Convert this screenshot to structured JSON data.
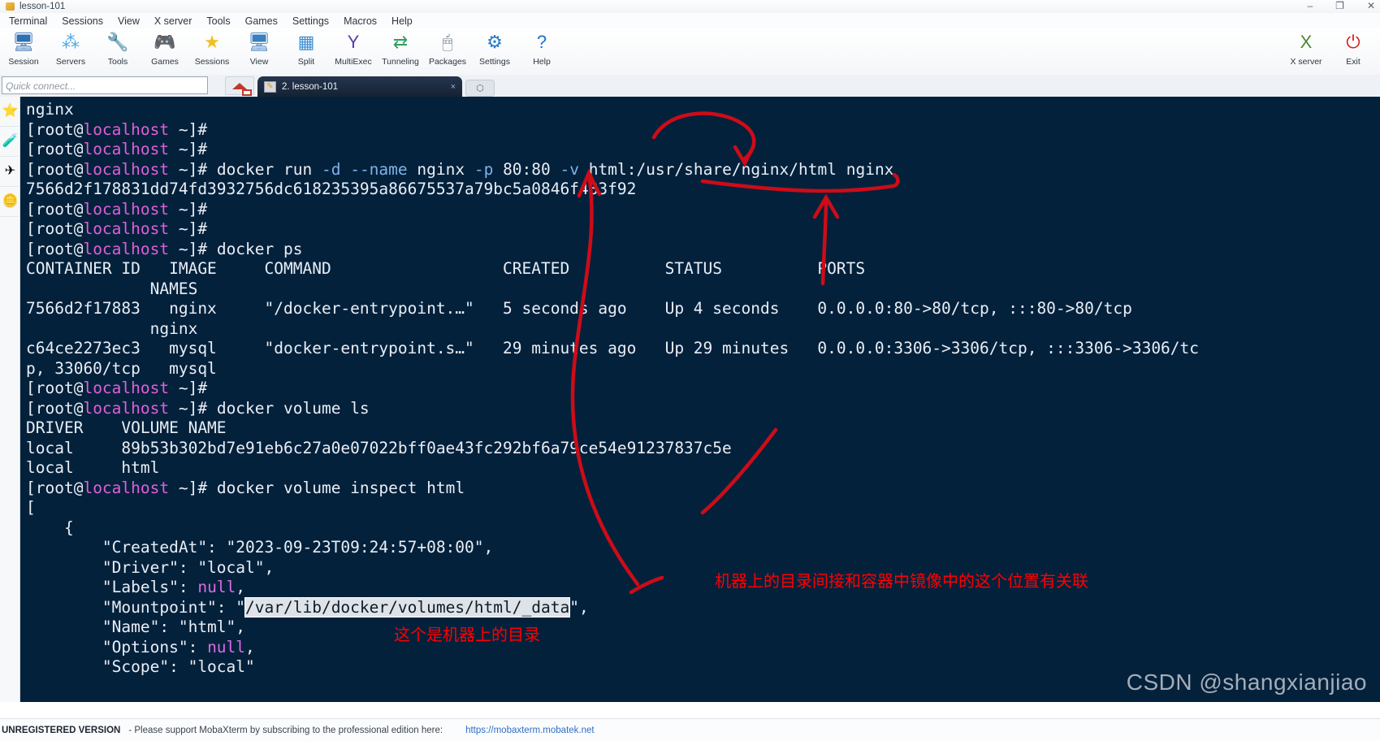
{
  "window": {
    "title": "lesson-101",
    "icon": "mobaxterm-icon",
    "buttons": [
      "–",
      "❐",
      "✕"
    ]
  },
  "menu": {
    "items": [
      "Terminal",
      "Sessions",
      "View",
      "X server",
      "Tools",
      "Games",
      "Settings",
      "Macros",
      "Help"
    ]
  },
  "toolbar": {
    "items": [
      {
        "label": "Session",
        "icon": "session-icon",
        "glyph": "🖥"
      },
      {
        "label": "Servers",
        "icon": "servers-icon",
        "glyph": "⁂"
      },
      {
        "label": "Tools",
        "icon": "tools-icon",
        "glyph": "🔧"
      },
      {
        "label": "Games",
        "icon": "games-icon",
        "glyph": "🎮"
      },
      {
        "label": "Sessions",
        "icon": "star-sessions-icon",
        "glyph": "★"
      },
      {
        "label": "View",
        "icon": "view-icon",
        "glyph": "🖥"
      },
      {
        "label": "Split",
        "icon": "split-icon",
        "glyph": "▦"
      },
      {
        "label": "MultiExec",
        "icon": "multiexec-icon",
        "glyph": "Y"
      },
      {
        "label": "Tunneling",
        "icon": "tunneling-icon",
        "glyph": "⇄"
      },
      {
        "label": "Packages",
        "icon": "packages-icon",
        "glyph": "🖱"
      },
      {
        "label": "Settings",
        "icon": "settings-gear-icon",
        "glyph": "⚙"
      },
      {
        "label": "Help",
        "icon": "help-icon",
        "glyph": "?"
      }
    ],
    "right_items": [
      {
        "label": "X server",
        "icon": "x-server-icon",
        "glyph": "X"
      },
      {
        "label": "Exit",
        "icon": "exit-power-icon",
        "glyph": "⏻"
      }
    ]
  },
  "quick_connect": {
    "placeholder": "Quick connect...",
    "value": "",
    "home_icon": "home-icon"
  },
  "tabs": {
    "active": {
      "label": "2. lesson-101",
      "icon": "terminal-tab-icon",
      "close_label": "×"
    },
    "new_tab_label": "⬡"
  },
  "sidebar": {
    "items": [
      {
        "icon": "favorites-star-icon",
        "glyph": "⭐"
      },
      {
        "icon": "tools-wrench-icon",
        "glyph": "🧪"
      },
      {
        "icon": "sftp-plane-icon",
        "glyph": "✈"
      },
      {
        "icon": "macros-coin-icon",
        "glyph": "🪙"
      }
    ]
  },
  "terminal": {
    "prompt_user": "[root@",
    "prompt_host": "localhost",
    "prompt_tail": " ~]# ",
    "lines": [
      {
        "segments": [
          {
            "t": "nginx"
          }
        ]
      },
      {
        "prompt": true,
        "segments": [
          {
            "t": ""
          }
        ]
      },
      {
        "prompt": true,
        "segments": [
          {
            "t": ""
          }
        ]
      },
      {
        "prompt": true,
        "segments": [
          {
            "t": "docker run "
          },
          {
            "t": "-d",
            "c": "c-opt"
          },
          {
            "t": " "
          },
          {
            "t": "--name",
            "c": "c-opt"
          },
          {
            "t": " nginx "
          },
          {
            "t": "-p",
            "c": "c-opt"
          },
          {
            "t": " 80:80 "
          },
          {
            "t": "-v",
            "c": "c-opt"
          },
          {
            "t": " html:/usr/share/nginx/html nginx"
          }
        ]
      },
      {
        "segments": [
          {
            "t": "7566d2f178831dd74fd3932756dc618235395a86675537a79bc5a0846f483f92"
          }
        ]
      },
      {
        "prompt": true,
        "segments": [
          {
            "t": ""
          }
        ]
      },
      {
        "prompt": true,
        "segments": [
          {
            "t": ""
          }
        ]
      },
      {
        "prompt": true,
        "segments": [
          {
            "t": "docker ps"
          }
        ]
      },
      {
        "segments": [
          {
            "t": "CONTAINER ID   IMAGE     COMMAND                  CREATED          STATUS          PORTS"
          }
        ]
      },
      {
        "segments": [
          {
            "t": "             NAMES"
          }
        ]
      },
      {
        "segments": [
          {
            "t": "7566d2f17883   nginx     \"/docker-entrypoint.…\"   5 seconds ago    Up 4 seconds    0.0.0.0:80->80/tcp, :::80->80/tcp"
          }
        ]
      },
      {
        "segments": [
          {
            "t": "             nginx"
          }
        ]
      },
      {
        "segments": [
          {
            "t": "c64ce2273ec3   mysql     \"docker-entrypoint.s…\"   29 minutes ago   Up 29 minutes   0.0.0.0:3306->3306/tcp, :::3306->3306/tc"
          }
        ]
      },
      {
        "segments": [
          {
            "t": "p, 33060/tcp   mysql"
          }
        ]
      },
      {
        "prompt": true,
        "segments": [
          {
            "t": ""
          }
        ]
      },
      {
        "prompt": true,
        "segments": [
          {
            "t": "docker volume ls"
          }
        ]
      },
      {
        "segments": [
          {
            "t": "DRIVER    VOLUME NAME"
          }
        ]
      },
      {
        "segments": [
          {
            "t": "local     89b53b302bd7e91eb6c27a0e07022bff0ae43fc292bf6a79ce54e91237837c5e"
          }
        ]
      },
      {
        "segments": [
          {
            "t": "local     html"
          }
        ]
      },
      {
        "prompt": true,
        "segments": [
          {
            "t": "docker volume inspect html"
          }
        ]
      },
      {
        "segments": [
          {
            "t": "["
          }
        ]
      },
      {
        "segments": [
          {
            "t": "    {"
          }
        ]
      },
      {
        "segments": [
          {
            "t": "        \"CreatedAt\": \"2023-09-23T09:24:57+08:00\","
          }
        ]
      },
      {
        "segments": [
          {
            "t": "        \"Driver\": \"local\","
          }
        ]
      },
      {
        "segments": [
          {
            "t": "        \"Labels\": "
          },
          {
            "t": "null",
            "c": "c-null"
          },
          {
            "t": ","
          }
        ]
      },
      {
        "segments": [
          {
            "t": "        \"Mountpoint\": \""
          },
          {
            "t": "/var/lib/docker/volumes/html/_data",
            "c": "sel"
          },
          {
            "t": "\","
          }
        ]
      },
      {
        "segments": [
          {
            "t": "        \"Name\": \"html\","
          }
        ]
      },
      {
        "segments": [
          {
            "t": "        \"Options\": "
          },
          {
            "t": "null",
            "c": "c-null"
          },
          {
            "t": ","
          }
        ]
      },
      {
        "segments": [
          {
            "t": "        \"Scope\": \"local\""
          }
        ]
      }
    ]
  },
  "annotations": {
    "color": "#ff0000",
    "note_top": "机器上的目录间接和容器中镜像中的这个位置有关联",
    "note_bottom": "这个是机器上的目录"
  },
  "watermark": "CSDN @shangxianjiao",
  "status_bar": {
    "unregistered": "UNREGISTERED VERSION",
    "message": "- Please support MobaXterm by subscribing to the professional edition here:",
    "link": "https://mobaxterm.mobatek.net"
  }
}
